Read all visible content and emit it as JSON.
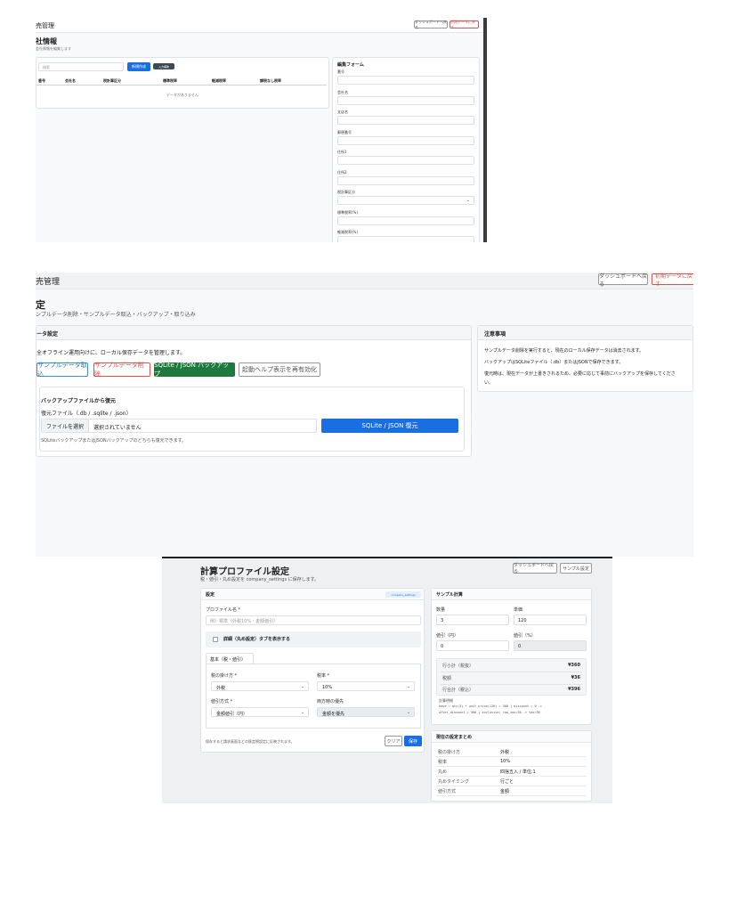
{
  "s1": {
    "app_title": "売管理",
    "btn_dashboard": "ダッシュボードへ戻る",
    "btn_init": "初期データに戻す",
    "page_title": "社情報",
    "page_sub": "会社情報を編集します",
    "search_placeholder": "検索",
    "btn_new": "新規作成",
    "btn_badge": "入力補助",
    "columns": [
      "番号",
      "会社名",
      "税計算区分",
      "標準税率",
      "軽減税率",
      "課税なし税率"
    ],
    "empty": "データがありません",
    "form_title": "編集フォーム",
    "fields": [
      "番号",
      "会社名",
      "支店名",
      "郵便番号",
      "住所1",
      "住所2",
      "税計算区分",
      "標準税率(%)",
      "軽減税率(%)"
    ]
  },
  "s2": {
    "app_title": "売管理",
    "btn_dashboard": "ダッシュボードへ戻る",
    "btn_init": "初期データに戻す",
    "page_title": "定",
    "page_sub": "ンプルデータ削除・サンプルデータ取込・バックアップ・取り込み",
    "card_title": "ータ設定",
    "card_desc": "全オフライン運用向けに、ローカル保存データを管理します。",
    "btn_import": "サンプルデータ取込",
    "btn_delete": "サンプルデータ削除",
    "btn_backup": "SQLite / JSON バックアップ",
    "btn_help": "起動ヘルプ表示を再有効化",
    "restore_title": "バックアップファイルから復元",
    "restore_label": "復元ファイル（.db / .sqlite / .json）",
    "file_btn": "ファイルを選択",
    "file_none": "選択されていません",
    "btn_restore": "SQLite / JSON 復元",
    "restore_note": "SQLiteバックアップまたはJSONバックアップのどちらも復元できます。",
    "notes_title": "注意事項",
    "notes": [
      "サンプルデータ削除を実行すると、現在のローカル保存データは消去されます。",
      "バックアップはSQLiteファイル（.db）またはJSONで保存できます。",
      "復元時は、現在データが上書きされるため、必要に応じて事前にバックアップを保存してくださ",
      "い。"
    ]
  },
  "s3": {
    "page_title": "計算プロファイル設定",
    "page_sub": "税・値引・丸め設定を company_settings に保存します。",
    "btn_dashboard": "ダッシュボードへ戻る",
    "btn_sample": "サンプル設定",
    "settings_title": "設定",
    "settings_badge": "company_settings",
    "profile_label": "プロファイル名 *",
    "profile_placeholder": "例）標準（外税10%・金額値引）",
    "detail_toggle": "詳細（丸め設定）タブを表示する",
    "tab_basic": "基本（税・値引）",
    "tax_method_label": "税の掛け方 *",
    "tax_method_value": "外税",
    "tax_rate_label": "税率 *",
    "tax_rate_value": "10%",
    "discount_method_label": "値引方式 *",
    "discount_method_value": "金額値引（円）",
    "priority_label": "両方時の優先",
    "priority_value": "金額を優先",
    "footer_note": "保存すると請求画面などの既定税設定に反映されます。",
    "btn_clear": "クリア",
    "btn_save": "保存",
    "sample_title": "サンプル計算",
    "qty_label": "数量",
    "qty_value": "3",
    "price_label": "単価",
    "price_value": "120",
    "disc_yen_label": "値引（円）",
    "disc_yen_value": "0",
    "disc_pct_label": "値引（%）",
    "disc_pct_value": "0",
    "result_rows": [
      {
        "label": "行小計（税抜）",
        "value": "¥360"
      },
      {
        "label": "税額",
        "value": "¥36"
      },
      {
        "label": "行合計（税込）",
        "value": "¥396"
      }
    ],
    "detail_label": "計算明細",
    "detail_lines": [
      "base = qty(3) * unit_price(120) = 360 | discount = 0 ->",
      "after_discount = 360 | exclusive: raw_tax=36 -> tax=36"
    ],
    "summary_title": "現在の設定まとめ",
    "summary_rows": [
      {
        "label": "税の掛け方",
        "value": "外税"
      },
      {
        "label": "税率",
        "value": "10%"
      },
      {
        "label": "丸め",
        "value": "四捨五入 / 単位:1"
      },
      {
        "label": "丸めタイミング",
        "value": "行ごと"
      },
      {
        "label": "値引方式",
        "value": "金額"
      }
    ]
  },
  "colors": {
    "primary": "#1a6fe0",
    "success": "#1e7a3c",
    "danger": "#d9534f"
  }
}
